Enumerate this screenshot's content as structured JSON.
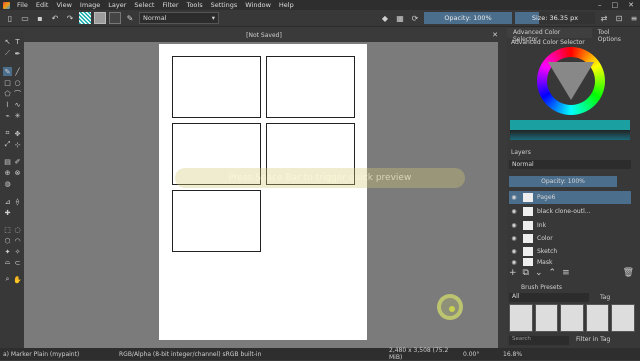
{
  "menu": {
    "items": [
      "File",
      "Edit",
      "View",
      "Image",
      "Layer",
      "Select",
      "Filter",
      "Tools",
      "Settings",
      "Window",
      "Help"
    ]
  },
  "toolbar": {
    "blend_mode": "Normal",
    "opacity": "Opacity: 100%",
    "size": "Size: 36.35 px"
  },
  "document": {
    "title": "[Not Saved]",
    "watermark": "Press Space Bar to trigger quick preview"
  },
  "dock": {
    "tabs": [
      "Advanced Color Selector",
      "Tool Options"
    ],
    "color_selector_title": "Advanced Color Selector",
    "layers_title": "Layers",
    "layers_blend": "Normal",
    "layers_opacity": "Opacity: 100%",
    "layers": [
      {
        "name": "Page6",
        "selected": true
      },
      {
        "name": "black clone-outl..."
      },
      {
        "name": "Ink"
      },
      {
        "name": "Color"
      },
      {
        "name": "Sketch"
      },
      {
        "name": "Mask"
      }
    ],
    "brush_title": "Brush Presets",
    "brush_filter": "All",
    "tag_label": "Tag",
    "search_placeholder": "Search",
    "filter_in_tag": "Filter in Tag"
  },
  "status": {
    "brush": "a) Marker Plain (mypaint)",
    "color": "RGB/Alpha (8-bit integer/channel)  sRGB built-in",
    "dims": "2,480 x 3,508 (75.2 MiB)",
    "rotation": "0.00°",
    "zoom": "16.8%"
  }
}
